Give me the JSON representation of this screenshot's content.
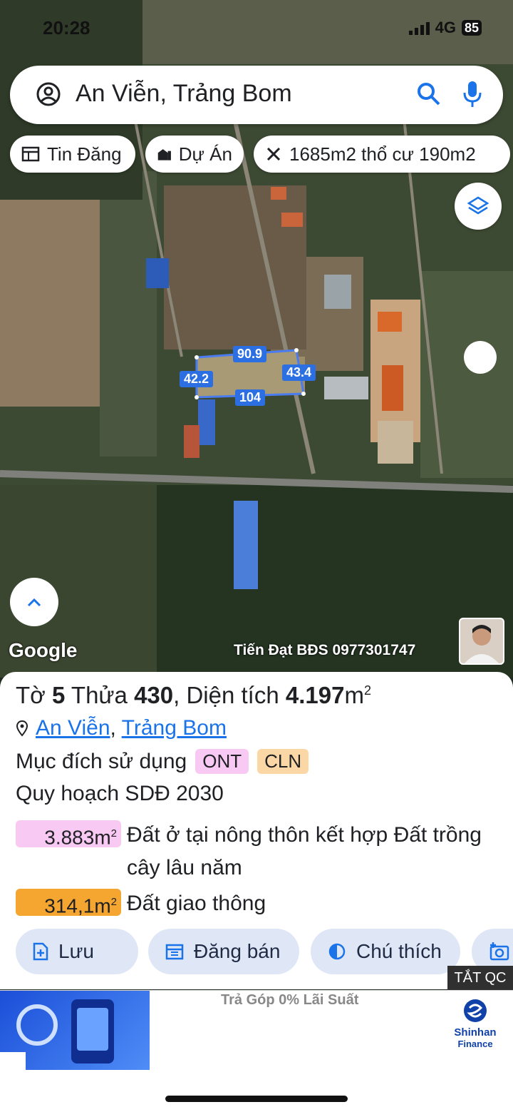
{
  "status_bar": {
    "time": "20:28",
    "network": "4G",
    "battery": "85"
  },
  "search": {
    "value": "An Viễn, Trảng Bom"
  },
  "chips": [
    {
      "label": "Tin Đăng",
      "icon": "listing-icon"
    },
    {
      "label": "Dự Án",
      "icon": "building-icon"
    },
    {
      "label": "1685m2 thổ cư 190m2",
      "icon": "measure-icon"
    }
  ],
  "map": {
    "dimensions": {
      "top": "90.9",
      "left": "42.2",
      "right": "43.4",
      "bottom": "104"
    },
    "attribution": "Google",
    "watermark": "Tiến Đạt BĐS 0977301747"
  },
  "parcel": {
    "title_prefix": "Tờ",
    "sheet_no": "5",
    "plot_label": "Thửa",
    "plot_no": "430",
    "area_label": "Diện tích",
    "area_value": "4.197",
    "unit": "m",
    "sup": "2",
    "commune": "An Viễn",
    "separator": ",",
    "district": "Trảng Bom",
    "purpose_label": "Mục đích sử dụng",
    "purpose_tags": [
      "ONT",
      "CLN"
    ],
    "plan_label": "Quy hoạch SDĐ 2030",
    "zones": [
      {
        "area": "3.883m",
        "sup": "2",
        "desc": "Đất ở tại nông thôn kết hợp Đất trồng cây lâu năm",
        "color": "#f8c9f3"
      },
      {
        "area": "314,1m",
        "sup": "2",
        "desc": "Đất giao thông",
        "color": "#f4a630"
      }
    ]
  },
  "actions": [
    {
      "label": "Lưu"
    },
    {
      "label": "Đăng bán"
    },
    {
      "label": "Chú thích"
    }
  ],
  "ad": {
    "hide_label": "TẮT QC",
    "headline": "Trả Góp 0% Lãi Suất",
    "brand_line1": "Shinhan",
    "brand_line2": "Finance"
  },
  "colors": {
    "ont": "#f8c9f3",
    "cln": "#fbd7a6",
    "link": "#1a73e8",
    "measure": "#2b6fe3"
  }
}
